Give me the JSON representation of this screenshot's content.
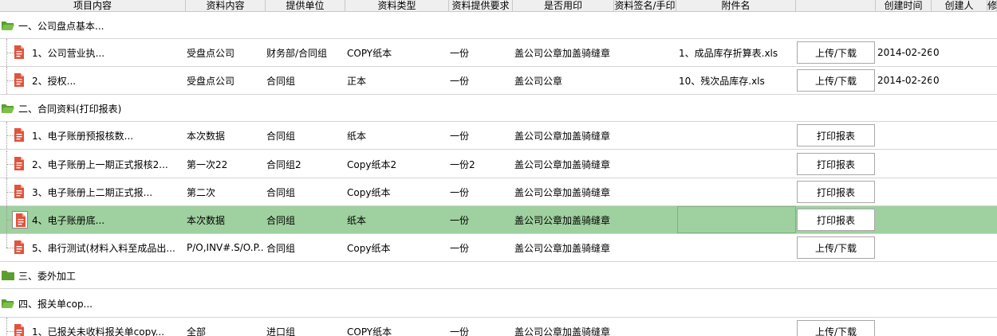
{
  "columns": [
    "项目内容",
    "资料内容",
    "提供单位",
    "资料类型",
    "资料提供要求",
    "是否用印",
    "资料签名/手印",
    "附件名",
    "",
    "创建时间",
    "创建人",
    "修"
  ],
  "rows": [
    {
      "kind": "group",
      "label": "一、公司盘点基本...",
      "folder": "open"
    },
    {
      "kind": "item",
      "label": "1、公司营业执...",
      "content": "受盘点公司",
      "unit": "财务部/合同组",
      "type": "COPY纸本",
      "req": "一份",
      "seal": "盖公司公章加盖骑缝章",
      "sign": "",
      "attach": "1、成品库存折算表.xls",
      "action": "上传/下载",
      "created": "2014-02-26",
      "creator": "0"
    },
    {
      "kind": "item",
      "label": "2、授权...",
      "content": "受盘点公司",
      "unit": "合同组",
      "type": "正本",
      "req": "一份",
      "seal": "盖公司公章",
      "sign": "",
      "attach": "10、残次品库存.xls",
      "action": "上传/下载",
      "created": "2014-02-26",
      "creator": "0"
    },
    {
      "kind": "group",
      "label": "二、合同资料(打印报表)",
      "folder": "open"
    },
    {
      "kind": "item",
      "label": "1、电子账册预报核数...",
      "content": "本次数据",
      "unit": "合同组",
      "type": "纸本",
      "req": "一份",
      "seal": "盖公司公章加盖骑缝章",
      "sign": "",
      "attach": "",
      "action": "打印报表",
      "created": "",
      "creator": ""
    },
    {
      "kind": "item",
      "label": "2、电子账册上一期正式报核2...",
      "content": "第一次22",
      "unit": "合同组2",
      "type": "Copy纸本2",
      "req": "一份2",
      "seal": "盖公司公章加盖骑缝章",
      "sign": "",
      "attach": "",
      "action": "打印报表",
      "created": "",
      "creator": ""
    },
    {
      "kind": "item",
      "label": "3、电子账册上二期正式报...",
      "content": "第二次",
      "unit": "合同组",
      "type": "Copy纸本",
      "req": "一份",
      "seal": "盖公司公章加盖骑缝章",
      "sign": "",
      "attach": "",
      "action": "打印报表",
      "created": "",
      "creator": ""
    },
    {
      "kind": "item",
      "label": "4、电子账册底...",
      "content": "本次数据",
      "unit": "合同组",
      "type": "纸本",
      "req": "一份",
      "seal": "盖公司公章加盖骑缝章",
      "sign": "",
      "attach": "",
      "action": "打印报表",
      "created": "",
      "creator": "",
      "selected": true
    },
    {
      "kind": "item",
      "label": "5、串行测试(材料入料至成品出...",
      "content": "P/O,INV#.S/O.P...",
      "unit": "合同组",
      "type": "Copy纸本",
      "req": "一份",
      "seal": "盖公司公章加盖骑缝章",
      "sign": "",
      "attach": "",
      "action": "上传/下载",
      "created": "",
      "creator": "",
      "last": true
    },
    {
      "kind": "group",
      "label": "三、委外加工",
      "folder": "closed"
    },
    {
      "kind": "group",
      "label": "四、报关单cop...",
      "folder": "open"
    },
    {
      "kind": "item",
      "label": "1、已报关未收料报关单copy...",
      "content": "全部",
      "unit": "进口组",
      "type": "COPY纸本",
      "req": "一份",
      "seal": "盖公司公章加盖骑缝章",
      "sign": "",
      "attach": "",
      "action": "上传/下载",
      "created": "",
      "creator": ""
    }
  ],
  "colors": {
    "selected_row": "#9fd09f",
    "folder": "#5a9e2f",
    "file_icon": "#e0533e"
  }
}
